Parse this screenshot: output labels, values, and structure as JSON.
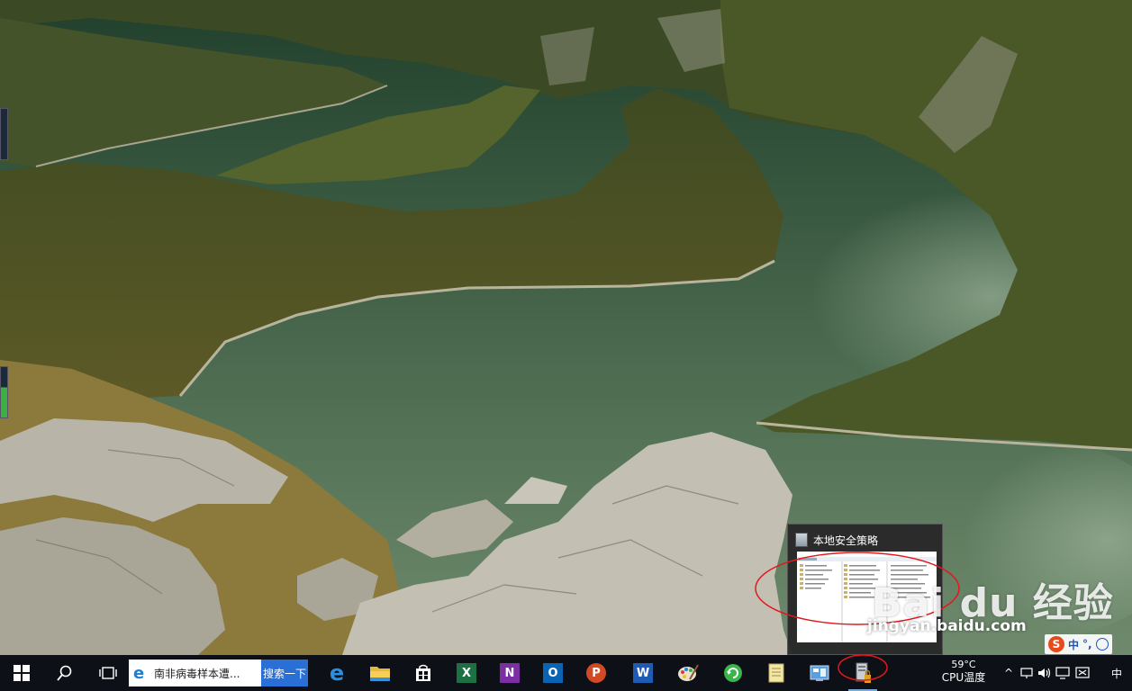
{
  "thumbnail": {
    "title": "本地安全策略"
  },
  "watermark": {
    "logo": "Bai du 经验",
    "url": "jingyan.baidu.com"
  },
  "ime": {
    "logo": "S",
    "mode": "中",
    "punct": "°,"
  },
  "taskbar": {
    "search_text": "南非病毒样本遭...",
    "search_button": "搜索一下",
    "cpu_temp_value": "59°C",
    "cpu_temp_label": "CPU温度",
    "tray_arrow": "^",
    "tray_ime": "中"
  },
  "colors": {
    "taskbar": "#0d1016",
    "search_button": "#2a6fd6",
    "highlight_circle": "#e3171c"
  }
}
